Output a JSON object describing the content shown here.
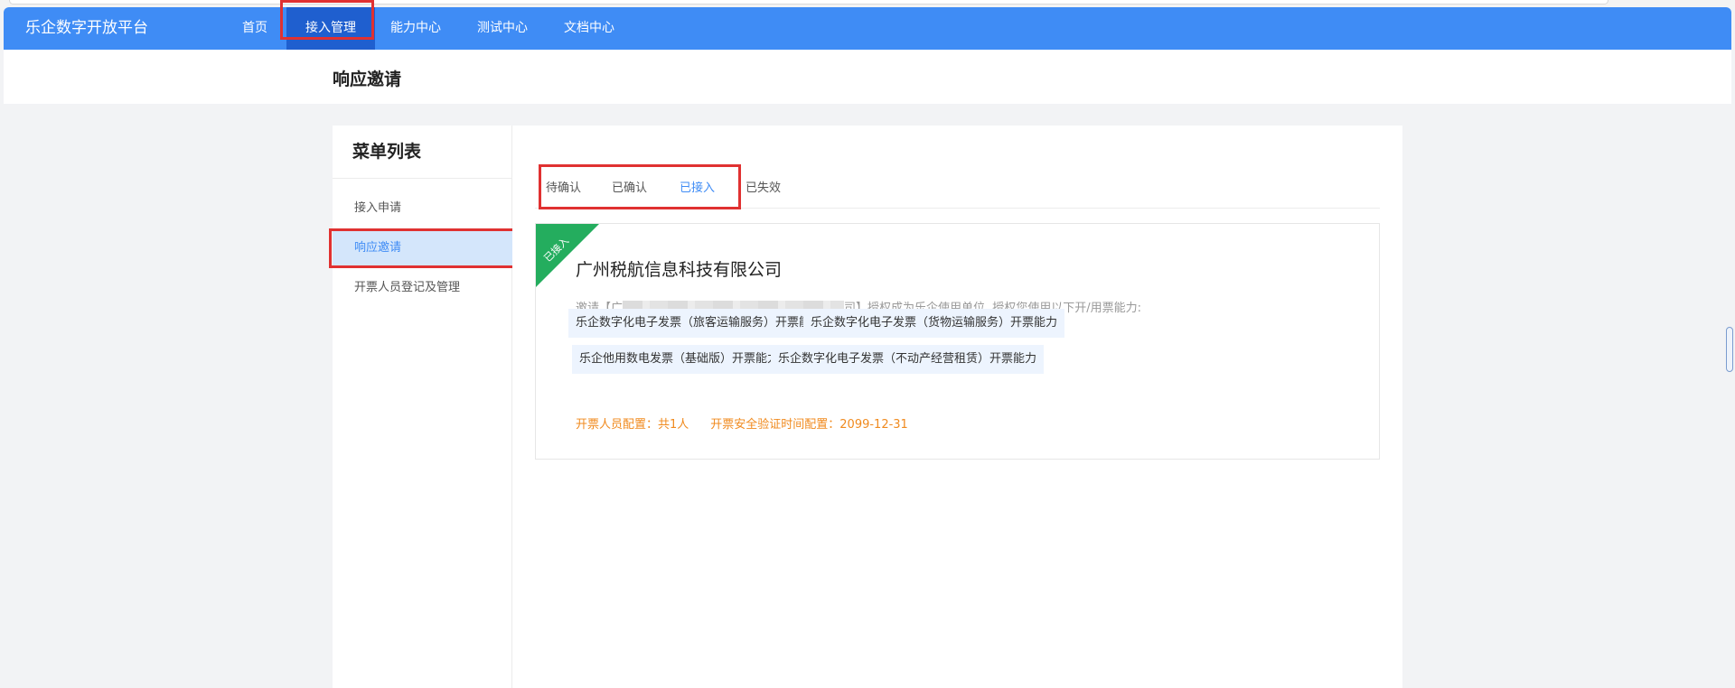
{
  "app": {
    "title": "乐企数字开放平台",
    "accent": "#3f8cf5",
    "highlight": "#e03131"
  },
  "nav": {
    "items": [
      {
        "label": "首页",
        "active": false
      },
      {
        "label": "接入管理",
        "active": true
      },
      {
        "label": "能力中心",
        "active": false
      },
      {
        "label": "测试中心",
        "active": false
      },
      {
        "label": "文档中心",
        "active": false
      }
    ]
  },
  "page": {
    "title": "响应邀请"
  },
  "sidebar": {
    "title": "菜单列表",
    "items": [
      {
        "label": "接入申请",
        "active": false
      },
      {
        "label": "响应邀请",
        "active": true
      },
      {
        "label": "开票人员登记及管理",
        "active": false
      }
    ]
  },
  "tabs": {
    "items": [
      {
        "label": "待确认",
        "active": false
      },
      {
        "label": "已确认",
        "active": false
      },
      {
        "label": "已接入",
        "active": true
      },
      {
        "label": "已失效",
        "active": false
      }
    ]
  },
  "card": {
    "ribbon": "已接入",
    "company": "广州税航信息科技有限公司",
    "invite_prefix": "邀请【广",
    "invite_suffix": "司】授权成为乐企使用单位, 授权您使用以下开/用票能力:",
    "capabilities": [
      "乐企数字化电子发票（旅客运输服务）开票能力",
      "乐企数字化电子发票（货物运输服务）开票能力",
      "乐企他用数电发票（基础版）开票能力",
      "乐企数字化电子发票（不动产经营租赁）开票能力"
    ],
    "stats": {
      "staff": "开票人员配置：共1人",
      "verify": "开票安全验证时间配置：2099-12-31"
    }
  }
}
